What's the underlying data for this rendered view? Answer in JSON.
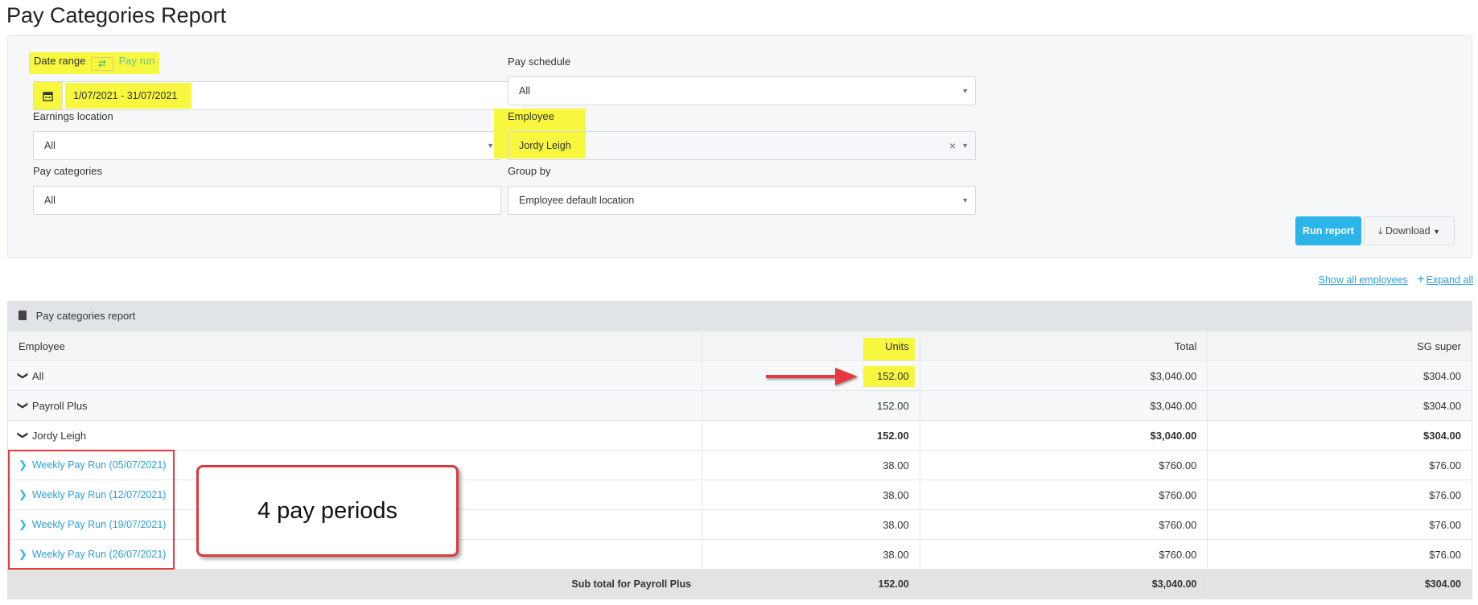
{
  "title": "Pay Categories Report",
  "filters": {
    "date_range_label": "Date range",
    "pay_run_label": "Pay run",
    "date_range_value": "1/07/2021 - 31/07/2021",
    "pay_schedule_label": "Pay schedule",
    "pay_schedule_value": "All",
    "earnings_location_label": "Earnings location",
    "earnings_location_value": "All",
    "employee_label": "Employee",
    "employee_value": "Jordy Leigh",
    "pay_categories_label": "Pay categories",
    "pay_categories_value": "All",
    "group_by_label": "Group by",
    "group_by_value": "Employee default location"
  },
  "actions": {
    "run_report": "Run report",
    "download": "Download"
  },
  "links": {
    "show_all_employees": "Show all employees",
    "expand_all": "Expand all"
  },
  "report": {
    "header": "Pay categories report",
    "columns": [
      "Employee",
      "Units",
      "Total",
      "SG super"
    ],
    "rows": [
      {
        "label": "All",
        "units": "152.00",
        "total": "$3,040.00",
        "super": "$304.00"
      },
      {
        "label": "Payroll Plus",
        "units": "152.00",
        "total": "$3,040.00",
        "super": "$304.00"
      },
      {
        "label": "Jordy Leigh",
        "units": "152.00",
        "total": "$3,040.00",
        "super": "$304.00"
      },
      {
        "label": "Weekly Pay Run (05/07/2021)",
        "units": "38.00",
        "total": "$760.00",
        "super": "$76.00"
      },
      {
        "label": "Weekly Pay Run (12/07/2021)",
        "units": "38.00",
        "total": "$760.00",
        "super": "$76.00"
      },
      {
        "label": "Weekly Pay Run (19/07/2021)",
        "units": "38.00",
        "total": "$760.00",
        "super": "$76.00"
      },
      {
        "label": "Weekly Pay Run (26/07/2021)",
        "units": "38.00",
        "total": "$760.00",
        "super": "$76.00"
      }
    ],
    "subtotal": {
      "label": "Sub total for Payroll Plus",
      "units": "152.00",
      "total": "$3,040.00",
      "super": "$304.00"
    }
  },
  "annotation": {
    "callout_text": "4 pay periods"
  },
  "colors": {
    "highlight": "#f7f73f",
    "primary_button": "#2cb5e8",
    "link": "#2a9fd6",
    "annotation_red": "#e5393f"
  },
  "icons": [
    "calendar-icon",
    "swap-icon",
    "chevron-down-icon",
    "chevron-right-icon",
    "clear-icon",
    "download-icon",
    "plus-icon",
    "document-icon",
    "arrow-annotation"
  ]
}
